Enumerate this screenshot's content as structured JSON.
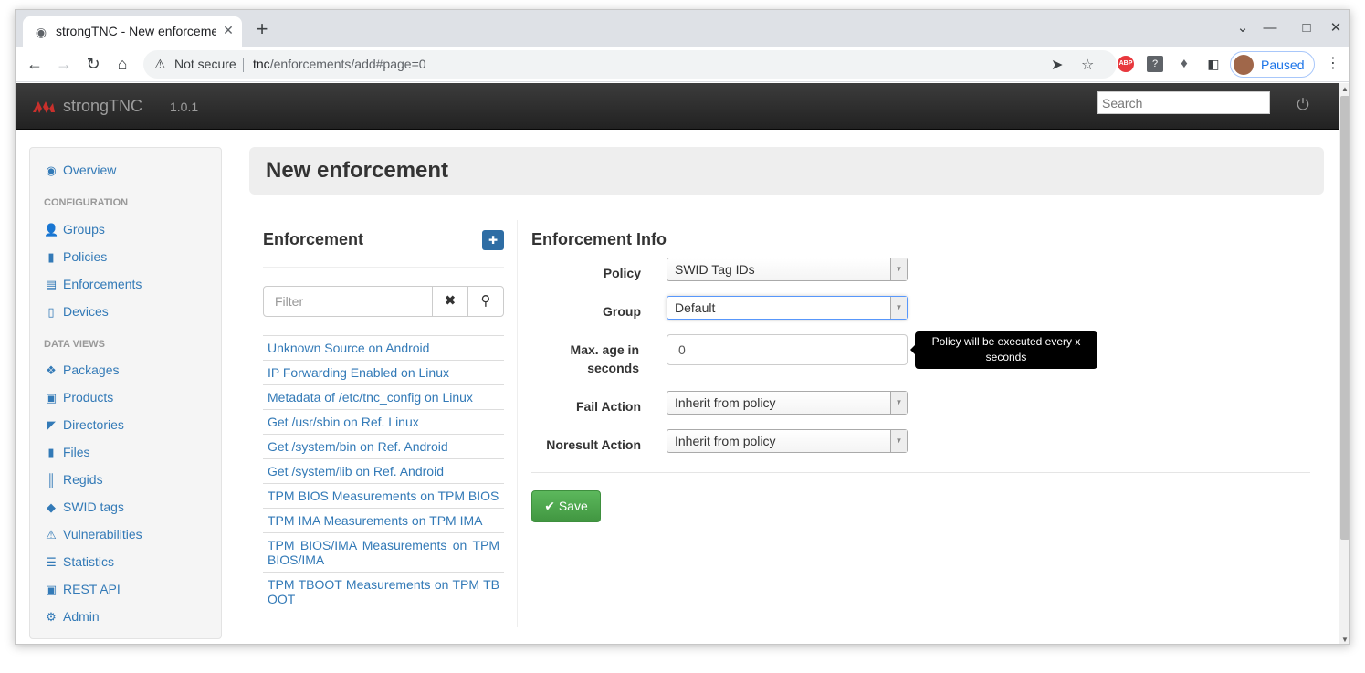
{
  "browser": {
    "tab_title": "strongTNC - New enforcement",
    "tab_favicon": "globe-icon",
    "new_tab_symbol": "+",
    "address": {
      "security_label": "Not secure",
      "host": "tnc",
      "path": "/enforcements/add#page=0"
    },
    "profile_label": "Paused",
    "extension_abp_label": "ABP",
    "extension_unknown_label": "?"
  },
  "app": {
    "brand_name": "strongTNC",
    "version": "1.0.1",
    "search_placeholder": "Search"
  },
  "sidebar": {
    "overview": "Overview",
    "section_configuration": "Configuration",
    "configuration_items": [
      {
        "label": "Groups",
        "icon": "user-icon"
      },
      {
        "label": "Policies",
        "icon": "book-icon"
      },
      {
        "label": "Enforcements",
        "icon": "list-icon"
      },
      {
        "label": "Devices",
        "icon": "phone-icon"
      }
    ],
    "section_data_views": "Data Views",
    "data_items": [
      {
        "label": "Packages",
        "icon": "packages-icon"
      },
      {
        "label": "Products",
        "icon": "briefcase-icon"
      },
      {
        "label": "Directories",
        "icon": "folder-icon"
      },
      {
        "label": "Files",
        "icon": "file-icon"
      },
      {
        "label": "Regids",
        "icon": "barcode-icon"
      },
      {
        "label": "SWID tags",
        "icon": "tag-icon"
      },
      {
        "label": "Vulnerabilities",
        "icon": "warning-icon"
      },
      {
        "label": "Statistics",
        "icon": "tasks-icon"
      },
      {
        "label": "REST API",
        "icon": "api-icon"
      },
      {
        "label": "Admin",
        "icon": "cog-icon"
      }
    ]
  },
  "page": {
    "title": "New enforcement"
  },
  "enforcement_list": {
    "title": "Enforcement",
    "filter_placeholder": "Filter",
    "items": [
      "Unknown Source on Android",
      "IP Forwarding Enabled on Linux",
      "Metadata of /etc/tnc_config on Linux",
      "Get /usr/sbin on Ref. Linux",
      "Get /system/bin on Ref. Android",
      "Get /system/lib on Ref. Android",
      "TPM BIOS Measurements on TPM BIOS",
      "TPM IMA Measurements on TPM IMA",
      "TPM BIOS/IMA Measurements on TPM BIOS/IMA",
      "TPM TBOOT Measurements on TPM TBOOT"
    ]
  },
  "form": {
    "title": "Enforcement Info",
    "policy_label": "Policy",
    "policy_value": "SWID Tag IDs",
    "group_label": "Group",
    "group_value": "Default",
    "max_age_label": "Max. age in seconds",
    "max_age_value": "0",
    "max_age_tooltip": "Policy will be executed every x seconds",
    "fail_action_label": "Fail Action",
    "fail_action_value": "Inherit from policy",
    "noresult_action_label": "Noresult Action",
    "noresult_action_value": "Inherit from policy",
    "save_label": "Save"
  },
  "colors": {
    "link": "#337ab7",
    "navbar": "#222222",
    "save": "#5cb85c",
    "brand_logo": "#c9302c"
  }
}
